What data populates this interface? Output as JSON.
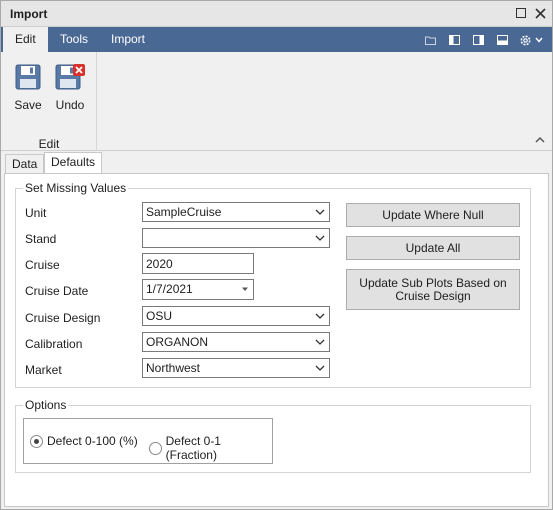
{
  "window": {
    "title": "Import"
  },
  "ribbon": {
    "tabs": [
      {
        "label": "Edit",
        "active": true
      },
      {
        "label": "Tools",
        "active": false
      },
      {
        "label": "Import",
        "active": false
      }
    ],
    "group": {
      "label": "Edit",
      "buttons": [
        {
          "label": "Save",
          "icon": "floppy-disk-icon"
        },
        {
          "label": "Undo",
          "icon": "floppy-disk-discard-icon"
        }
      ]
    }
  },
  "doc_tabs": [
    {
      "label": "Data",
      "active": false
    },
    {
      "label": "Defaults",
      "active": true
    }
  ],
  "missing_values": {
    "legend": "Set Missing Values",
    "fields": {
      "unit": {
        "label": "Unit",
        "value": "SampleCruise"
      },
      "stand": {
        "label": "Stand",
        "value": ""
      },
      "cruise": {
        "label": "Cruise",
        "value": "2020"
      },
      "cruise_date": {
        "label": "Cruise Date",
        "value": "1/7/2021"
      },
      "cruise_design": {
        "label": "Cruise Design",
        "value": "OSU"
      },
      "calibration": {
        "label": "Calibration",
        "value": "ORGANON"
      },
      "market": {
        "label": "Market",
        "value": "Northwest"
      }
    },
    "buttons": {
      "update_where_null": "Update Where Null",
      "update_all": "Update All",
      "update_sub_plots": "Update Sub Plots Based on Cruise Design"
    }
  },
  "options": {
    "legend": "Options",
    "defect_percent": {
      "label": "Defect 0-100 (%)",
      "checked": true
    },
    "defect_fraction": {
      "label": "Defect 0-1 (Fraction)",
      "checked": false
    }
  },
  "colors": {
    "ribbon_bar": "#4a6894",
    "accent_red": "#d9302c"
  }
}
